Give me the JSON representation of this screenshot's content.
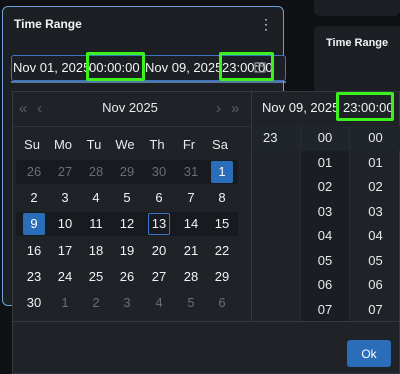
{
  "card": {
    "title": "Time Range",
    "menu_icon": "kebab-menu-icon"
  },
  "card2": {
    "title": "Time Range"
  },
  "range": {
    "start_date": "Nov 01, 2025",
    "start_time": "00:00:00",
    "end_date": "Nov 09, 2025",
    "end_time": "23:00:00",
    "icon": "calendar-icon"
  },
  "picker": {
    "month_label": "Nov 2025",
    "nav": {
      "prev_year": "«",
      "prev_month": "‹",
      "next_month": "›",
      "next_year": "»"
    },
    "weekdays": [
      "Su",
      "Mo",
      "Tu",
      "We",
      "Th",
      "Fr",
      "Sa"
    ],
    "weeks": [
      [
        "26",
        "27",
        "28",
        "29",
        "30",
        "31",
        "1"
      ],
      [
        "2",
        "3",
        "4",
        "5",
        "6",
        "7",
        "8"
      ],
      [
        "9",
        "10",
        "11",
        "12",
        "13",
        "14",
        "15"
      ],
      [
        "16",
        "17",
        "18",
        "19",
        "20",
        "21",
        "22"
      ],
      [
        "23",
        "24",
        "25",
        "26",
        "27",
        "28",
        "29"
      ],
      [
        "30",
        "1",
        "2",
        "3",
        "4",
        "5",
        "6"
      ]
    ],
    "time_header_date": "Nov 09, 2025",
    "time_header_time": "23:00:00",
    "hours": [
      "23"
    ],
    "minutes": [
      "00",
      "01",
      "02",
      "03",
      "04",
      "05",
      "06",
      "07"
    ],
    "seconds": [
      "00",
      "01",
      "02",
      "03",
      "04",
      "05",
      "06",
      "07"
    ],
    "ok_label": "Ok",
    "colors": {
      "accent": "#2a6db8",
      "highlight": "#3cf21c"
    }
  }
}
